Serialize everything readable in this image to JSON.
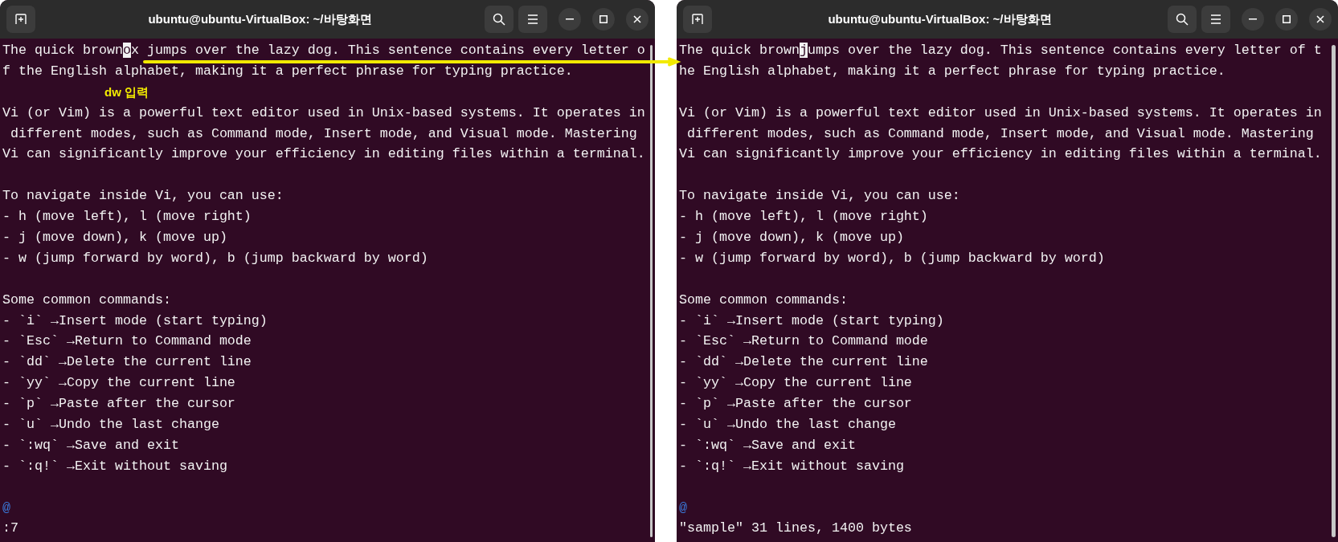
{
  "windows": [
    {
      "title": "ubuntu@ubuntu-VirtualBox: ~/바탕화면",
      "status": ":7",
      "lines": [
        {
          "kind": "cursor",
          "before": "The quick brown",
          "cursor": "o",
          "after": "x jumps over the lazy dog. This sentence contains every letter o"
        },
        {
          "kind": "text",
          "text": "f the English alphabet, making it a perfect phrase for typing practice."
        },
        {
          "kind": "note",
          "text": "dw 입력"
        },
        {
          "kind": "text",
          "text": "Vi (or Vim) is a powerful text editor used in Unix-based systems. It operates in"
        },
        {
          "kind": "text",
          "text": " different modes, such as Command mode, Insert mode, and Visual mode. Mastering"
        },
        {
          "kind": "text",
          "text": "Vi can significantly improve your efficiency in editing files within a terminal."
        },
        {
          "kind": "blank"
        },
        {
          "kind": "text",
          "text": "To navigate inside Vi, you can use:"
        },
        {
          "kind": "text",
          "text": "- h (move left), l (move right)"
        },
        {
          "kind": "text",
          "text": "- j (move down), k (move up)"
        },
        {
          "kind": "text",
          "text": "- w (jump forward by word), b (jump backward by word)"
        },
        {
          "kind": "blank"
        },
        {
          "kind": "text",
          "text": "Some common commands:"
        },
        {
          "kind": "text",
          "text": "- `i` →Insert mode (start typing)"
        },
        {
          "kind": "text",
          "text": "- `Esc` →Return to Command mode"
        },
        {
          "kind": "text",
          "text": "- `dd` →Delete the current line"
        },
        {
          "kind": "text",
          "text": "- `yy` →Copy the current line"
        },
        {
          "kind": "text",
          "text": "- `p` →Paste after the cursor"
        },
        {
          "kind": "text",
          "text": "- `u` →Undo the last change"
        },
        {
          "kind": "text",
          "text": "- `:wq` →Save and exit"
        },
        {
          "kind": "text",
          "text": "- `:q!` →Exit without saving"
        },
        {
          "kind": "blank"
        },
        {
          "kind": "marker",
          "text": "@"
        }
      ]
    },
    {
      "title": "ubuntu@ubuntu-VirtualBox: ~/바탕화면",
      "status": "\"sample\" 31 lines, 1400 bytes",
      "lines": [
        {
          "kind": "cursor",
          "before": "The quick brown",
          "cursor": "j",
          "after": "umps over the lazy dog. This sentence contains every letter of t"
        },
        {
          "kind": "text",
          "text": "he English alphabet, making it a perfect phrase for typing practice."
        },
        {
          "kind": "blank"
        },
        {
          "kind": "text",
          "text": "Vi (or Vim) is a powerful text editor used in Unix-based systems. It operates in"
        },
        {
          "kind": "text",
          "text": " different modes, such as Command mode, Insert mode, and Visual mode. Mastering"
        },
        {
          "kind": "text",
          "text": "Vi can significantly improve your efficiency in editing files within a terminal."
        },
        {
          "kind": "blank"
        },
        {
          "kind": "text",
          "text": "To navigate inside Vi, you can use:"
        },
        {
          "kind": "text",
          "text": "- h (move left), l (move right)"
        },
        {
          "kind": "text",
          "text": "- j (move down), k (move up)"
        },
        {
          "kind": "text",
          "text": "- w (jump forward by word), b (jump backward by word)"
        },
        {
          "kind": "blank"
        },
        {
          "kind": "text",
          "text": "Some common commands:"
        },
        {
          "kind": "text",
          "text": "- `i` →Insert mode (start typing)"
        },
        {
          "kind": "text",
          "text": "- `Esc` →Return to Command mode"
        },
        {
          "kind": "text",
          "text": "- `dd` →Delete the current line"
        },
        {
          "kind": "text",
          "text": "- `yy` →Copy the current line"
        },
        {
          "kind": "text",
          "text": "- `p` →Paste after the cursor"
        },
        {
          "kind": "text",
          "text": "- `u` →Undo the last change"
        },
        {
          "kind": "text",
          "text": "- `:wq` →Save and exit"
        },
        {
          "kind": "text",
          "text": "- `:q!` →Exit without saving"
        },
        {
          "kind": "blank"
        },
        {
          "kind": "marker",
          "text": "@"
        }
      ]
    }
  ]
}
